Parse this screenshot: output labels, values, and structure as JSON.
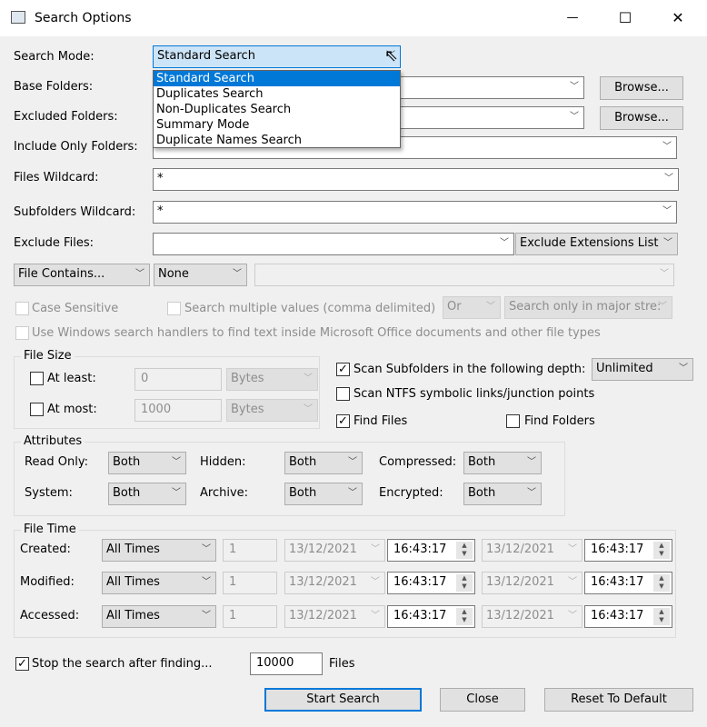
{
  "window": {
    "title": "Search Options",
    "minimize": "—",
    "maximize": "☐",
    "close": "✕"
  },
  "search_mode": {
    "label": "Search Mode:",
    "value": "Standard Search",
    "options": [
      "Standard Search",
      "Duplicates Search",
      "Non-Duplicates Search",
      "Summary Mode",
      "Duplicate Names Search"
    ]
  },
  "base_folders": {
    "label": "Base Folders:",
    "value": "",
    "browse": "Browse..."
  },
  "excluded_folders": {
    "label": "Excluded Folders:",
    "value": "",
    "browse": "Browse..."
  },
  "include_only": {
    "label": "Include Only Folders:",
    "value": ""
  },
  "files_wildcard": {
    "label": "Files Wildcard:",
    "value": "*"
  },
  "subfolders_wildcard": {
    "label": "Subfolders Wildcard:",
    "value": "*"
  },
  "exclude_files": {
    "label": "Exclude Files:",
    "value": "",
    "list": "Exclude Extensions List"
  },
  "contains": {
    "mode": "File Contains...",
    "type": "None",
    "value": ""
  },
  "case_sensitive": {
    "label": "Case Sensitive",
    "checked": false
  },
  "multiple_values": {
    "label": "Search multiple values (comma delimited)",
    "checked": false,
    "operator": "Or",
    "streams": "Search only in major stre:"
  },
  "windows_handlers": {
    "label": "Use Windows search handlers to find text inside Microsoft Office documents and other file types",
    "checked": false
  },
  "file_size": {
    "title": "File Size",
    "at_least": {
      "label": "At least:",
      "checked": false,
      "value": "0",
      "unit": "Bytes"
    },
    "at_most": {
      "label": "At most:",
      "checked": false,
      "value": "1000",
      "unit": "Bytes"
    }
  },
  "scan_subfolders": {
    "label": "Scan Subfolders in the following depth:",
    "checked": true,
    "depth": "Unlimited"
  },
  "scan_ntfs": {
    "label": "Scan NTFS symbolic links/junction points",
    "checked": false
  },
  "find_files": {
    "label": "Find Files",
    "checked": true
  },
  "find_folders": {
    "label": "Find Folders",
    "checked": false
  },
  "attributes": {
    "title": "Attributes",
    "items": [
      {
        "label": "Read Only:",
        "value": "Both"
      },
      {
        "label": "Hidden:",
        "value": "Both"
      },
      {
        "label": "Compressed:",
        "value": "Both"
      },
      {
        "label": "System:",
        "value": "Both"
      },
      {
        "label": "Archive:",
        "value": "Both"
      },
      {
        "label": "Encrypted:",
        "value": "Both"
      }
    ]
  },
  "file_time": {
    "title": "File Time",
    "rows": [
      {
        "label": "Created:",
        "mode": "All Times",
        "num": "1",
        "date1": "13/12/2021",
        "time1": "16:43:17",
        "date2": "13/12/2021",
        "time2": "16:43:17"
      },
      {
        "label": "Modified:",
        "mode": "All Times",
        "num": "1",
        "date1": "13/12/2021",
        "time1": "16:43:17",
        "date2": "13/12/2021",
        "time2": "16:43:17"
      },
      {
        "label": "Accessed:",
        "mode": "All Times",
        "num": "1",
        "date1": "13/12/2021",
        "time1": "16:43:17",
        "date2": "13/12/2021",
        "time2": "16:43:17"
      }
    ]
  },
  "stop_after": {
    "label": "Stop the search after finding...",
    "checked": true,
    "value": "10000",
    "unit": "Files"
  },
  "buttons": {
    "start": "Start Search",
    "close": "Close",
    "reset": "Reset To Default"
  }
}
